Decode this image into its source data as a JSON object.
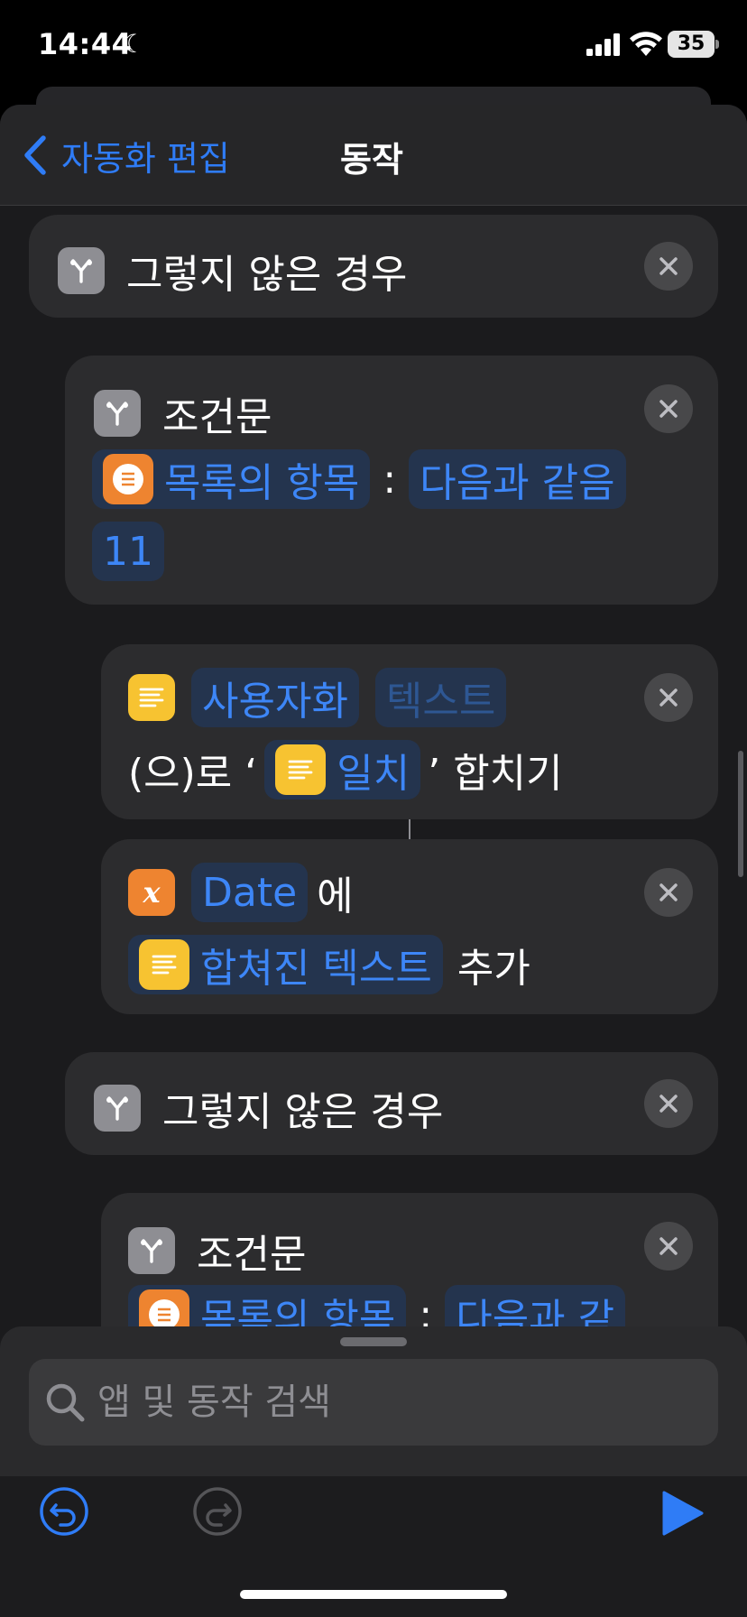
{
  "status_bar": {
    "time": "14:44",
    "battery": "35"
  },
  "nav": {
    "back_label": "자동화 편집",
    "title": "동작"
  },
  "actions": {
    "otherwise_1": {
      "label": "그렇지 않은 경우"
    },
    "if_1": {
      "label": "조건문",
      "variable": "목록의 항목",
      "colon": ":",
      "condition": "다음과 같음",
      "value": "11"
    },
    "combine": {
      "custom_token": "사용자화",
      "text_token": "텍스트",
      "prefix": "(으)로 ‘",
      "match_token": "일치",
      "suffix": "’ 합치기"
    },
    "add": {
      "variable": "Date",
      "particle": "에",
      "text_token": "합쳐진 텍스트",
      "verb": "추가"
    },
    "otherwise_2": {
      "label": "그렇지 않은 경우"
    },
    "if_2": {
      "label": "조건문",
      "variable": "목록의 항목",
      "colon": ":",
      "condition": "다음과 같"
    }
  },
  "search": {
    "placeholder": "앱 및 동작 검색"
  },
  "colors": {
    "accent": "#2f7cf6",
    "token_bg": "#24344e",
    "card_bg": "#2c2c2e",
    "yellow": "#f7c331",
    "orange": "#ee8430"
  }
}
